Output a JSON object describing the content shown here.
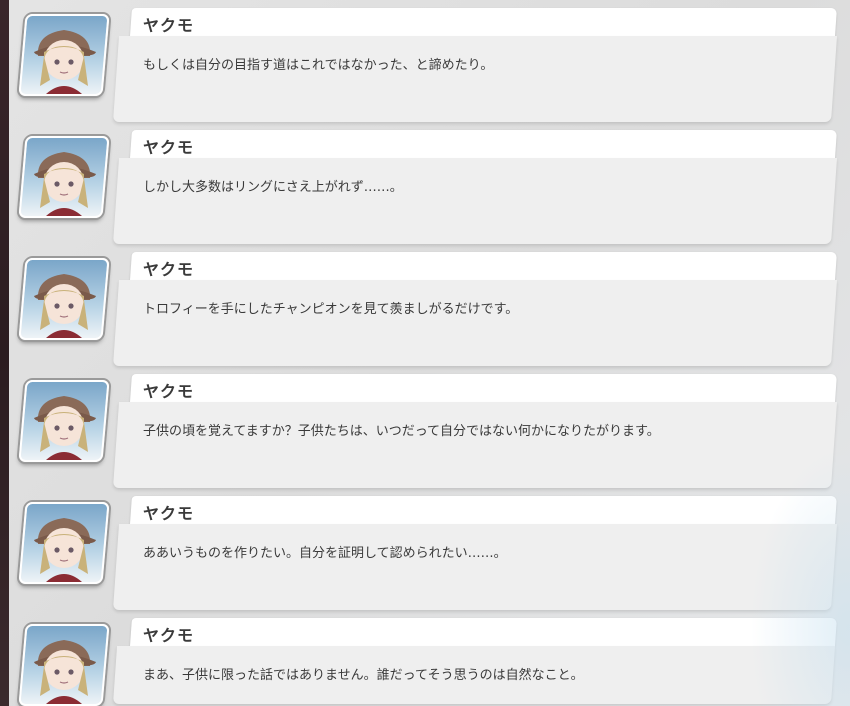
{
  "dialogue_log": {
    "entries": [
      {
        "speaker": "ヤクモ",
        "text": "もしくは自分の目指す道はこれではなかった、と諦めたり。"
      },
      {
        "speaker": "ヤクモ",
        "text": "しかし大多数はリングにさえ上がれず……。"
      },
      {
        "speaker": "ヤクモ",
        "text": "トロフィーを手にしたチャンピオンを見て羨ましがるだけです。"
      },
      {
        "speaker": "ヤクモ",
        "text": "子供の頃を覚えてますか？子供たちは、いつだって自分ではない何かになりたがります。"
      },
      {
        "speaker": "ヤクモ",
        "text": "ああいうものを作りたい。自分を証明して認められたい……。"
      },
      {
        "speaker": "ヤクモ",
        "text": "まあ、子供に限った話ではありません。誰だってそう思うのは自然なこと。"
      }
    ]
  },
  "colors": {
    "name_bar": "#ffffff",
    "bubble": "#efefef",
    "text": "#3a3a3a",
    "panel": "#dcdcdc"
  },
  "icons": {
    "avatar": "character-portrait-icon"
  }
}
